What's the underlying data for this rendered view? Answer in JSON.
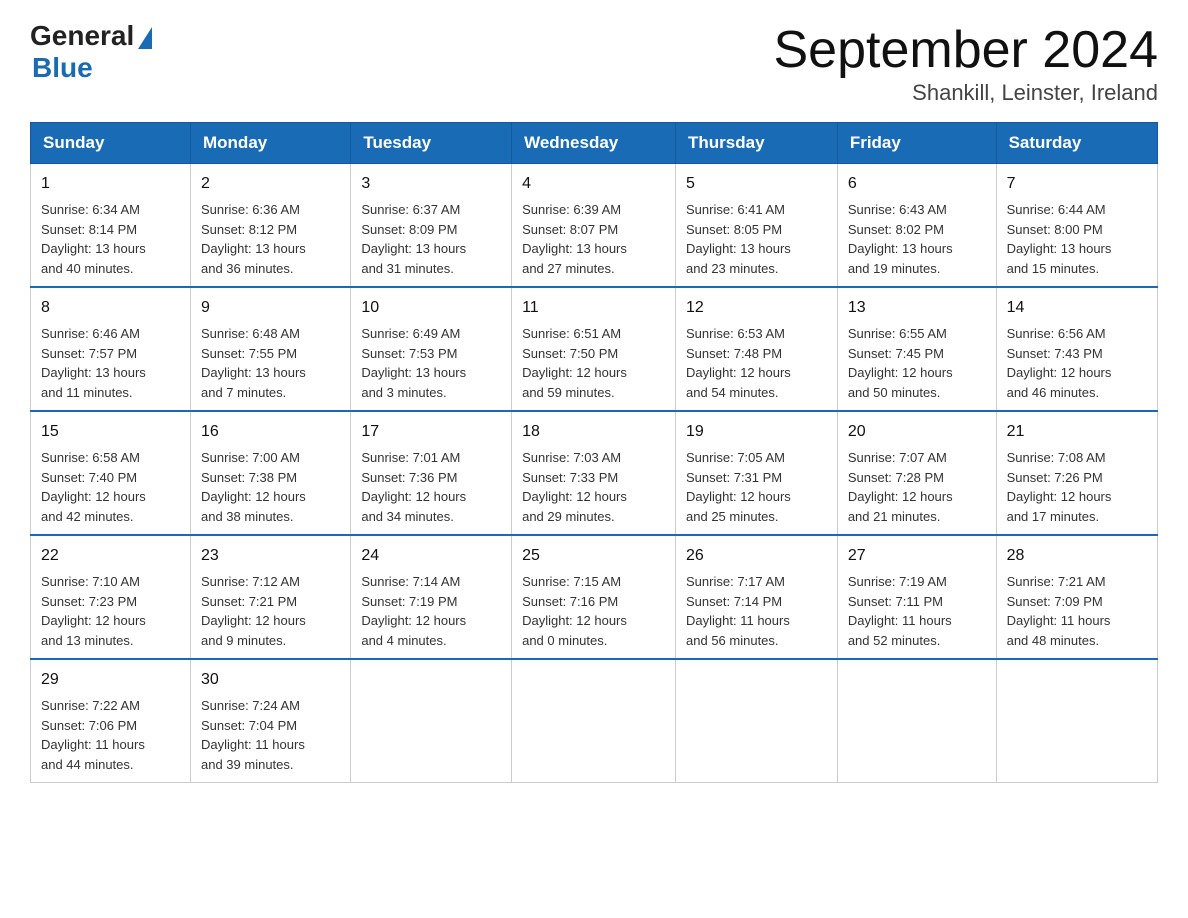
{
  "header": {
    "logo_general": "General",
    "logo_blue": "Blue",
    "title": "September 2024",
    "subtitle": "Shankill, Leinster, Ireland"
  },
  "days_of_week": [
    "Sunday",
    "Monday",
    "Tuesday",
    "Wednesday",
    "Thursday",
    "Friday",
    "Saturday"
  ],
  "weeks": [
    [
      {
        "day": "1",
        "info": "Sunrise: 6:34 AM\nSunset: 8:14 PM\nDaylight: 13 hours\nand 40 minutes."
      },
      {
        "day": "2",
        "info": "Sunrise: 6:36 AM\nSunset: 8:12 PM\nDaylight: 13 hours\nand 36 minutes."
      },
      {
        "day": "3",
        "info": "Sunrise: 6:37 AM\nSunset: 8:09 PM\nDaylight: 13 hours\nand 31 minutes."
      },
      {
        "day": "4",
        "info": "Sunrise: 6:39 AM\nSunset: 8:07 PM\nDaylight: 13 hours\nand 27 minutes."
      },
      {
        "day": "5",
        "info": "Sunrise: 6:41 AM\nSunset: 8:05 PM\nDaylight: 13 hours\nand 23 minutes."
      },
      {
        "day": "6",
        "info": "Sunrise: 6:43 AM\nSunset: 8:02 PM\nDaylight: 13 hours\nand 19 minutes."
      },
      {
        "day": "7",
        "info": "Sunrise: 6:44 AM\nSunset: 8:00 PM\nDaylight: 13 hours\nand 15 minutes."
      }
    ],
    [
      {
        "day": "8",
        "info": "Sunrise: 6:46 AM\nSunset: 7:57 PM\nDaylight: 13 hours\nand 11 minutes."
      },
      {
        "day": "9",
        "info": "Sunrise: 6:48 AM\nSunset: 7:55 PM\nDaylight: 13 hours\nand 7 minutes."
      },
      {
        "day": "10",
        "info": "Sunrise: 6:49 AM\nSunset: 7:53 PM\nDaylight: 13 hours\nand 3 minutes."
      },
      {
        "day": "11",
        "info": "Sunrise: 6:51 AM\nSunset: 7:50 PM\nDaylight: 12 hours\nand 59 minutes."
      },
      {
        "day": "12",
        "info": "Sunrise: 6:53 AM\nSunset: 7:48 PM\nDaylight: 12 hours\nand 54 minutes."
      },
      {
        "day": "13",
        "info": "Sunrise: 6:55 AM\nSunset: 7:45 PM\nDaylight: 12 hours\nand 50 minutes."
      },
      {
        "day": "14",
        "info": "Sunrise: 6:56 AM\nSunset: 7:43 PM\nDaylight: 12 hours\nand 46 minutes."
      }
    ],
    [
      {
        "day": "15",
        "info": "Sunrise: 6:58 AM\nSunset: 7:40 PM\nDaylight: 12 hours\nand 42 minutes."
      },
      {
        "day": "16",
        "info": "Sunrise: 7:00 AM\nSunset: 7:38 PM\nDaylight: 12 hours\nand 38 minutes."
      },
      {
        "day": "17",
        "info": "Sunrise: 7:01 AM\nSunset: 7:36 PM\nDaylight: 12 hours\nand 34 minutes."
      },
      {
        "day": "18",
        "info": "Sunrise: 7:03 AM\nSunset: 7:33 PM\nDaylight: 12 hours\nand 29 minutes."
      },
      {
        "day": "19",
        "info": "Sunrise: 7:05 AM\nSunset: 7:31 PM\nDaylight: 12 hours\nand 25 minutes."
      },
      {
        "day": "20",
        "info": "Sunrise: 7:07 AM\nSunset: 7:28 PM\nDaylight: 12 hours\nand 21 minutes."
      },
      {
        "day": "21",
        "info": "Sunrise: 7:08 AM\nSunset: 7:26 PM\nDaylight: 12 hours\nand 17 minutes."
      }
    ],
    [
      {
        "day": "22",
        "info": "Sunrise: 7:10 AM\nSunset: 7:23 PM\nDaylight: 12 hours\nand 13 minutes."
      },
      {
        "day": "23",
        "info": "Sunrise: 7:12 AM\nSunset: 7:21 PM\nDaylight: 12 hours\nand 9 minutes."
      },
      {
        "day": "24",
        "info": "Sunrise: 7:14 AM\nSunset: 7:19 PM\nDaylight: 12 hours\nand 4 minutes."
      },
      {
        "day": "25",
        "info": "Sunrise: 7:15 AM\nSunset: 7:16 PM\nDaylight: 12 hours\nand 0 minutes."
      },
      {
        "day": "26",
        "info": "Sunrise: 7:17 AM\nSunset: 7:14 PM\nDaylight: 11 hours\nand 56 minutes."
      },
      {
        "day": "27",
        "info": "Sunrise: 7:19 AM\nSunset: 7:11 PM\nDaylight: 11 hours\nand 52 minutes."
      },
      {
        "day": "28",
        "info": "Sunrise: 7:21 AM\nSunset: 7:09 PM\nDaylight: 11 hours\nand 48 minutes."
      }
    ],
    [
      {
        "day": "29",
        "info": "Sunrise: 7:22 AM\nSunset: 7:06 PM\nDaylight: 11 hours\nand 44 minutes."
      },
      {
        "day": "30",
        "info": "Sunrise: 7:24 AM\nSunset: 7:04 PM\nDaylight: 11 hours\nand 39 minutes."
      },
      null,
      null,
      null,
      null,
      null
    ]
  ]
}
